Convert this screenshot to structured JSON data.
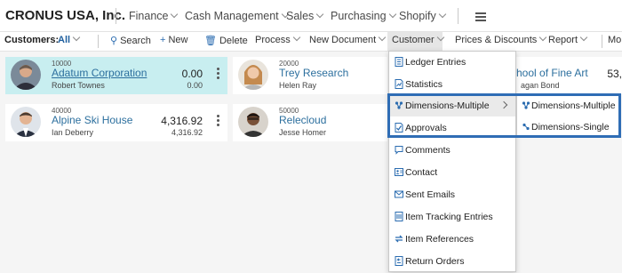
{
  "app": {
    "company": "CRONUS USA, Inc.",
    "nav": [
      {
        "label": "Finance"
      },
      {
        "label": "Cash Management"
      },
      {
        "label": "Sales"
      },
      {
        "label": "Purchasing"
      },
      {
        "label": "Shopify"
      }
    ]
  },
  "actions": {
    "customers_label": "Customers:",
    "filter_all": "All",
    "search": "Search",
    "new": "New",
    "delete": "Delete",
    "process": "Process",
    "new_document": "New Document",
    "customer": "Customer",
    "prices_discounts": "Prices & Discounts",
    "report": "Report",
    "more_clip": "Mo"
  },
  "customers": [
    {
      "number": "10000",
      "name": "Adatum Corporation",
      "contact": "Robert Townes",
      "balance": "0.00",
      "balance2": "0.00",
      "selected": true
    },
    {
      "number": "20000",
      "name": "Trey Research",
      "contact": "Helen Ray",
      "balance": "",
      "balance2": "",
      "selected": false
    },
    {
      "number": "",
      "name": "hool of Fine Art",
      "contact": "agan Bond",
      "balance": "53,",
      "balance2": "",
      "selected": false
    },
    {
      "number": "40000",
      "name": "Alpine Ski House",
      "contact": "Ian Deberry",
      "balance": "4,316.92",
      "balance2": "4,316.92",
      "selected": false
    },
    {
      "number": "50000",
      "name": "Relecloud",
      "contact": "Jesse Homer",
      "balance": "",
      "balance2": "",
      "selected": false
    }
  ],
  "menu": {
    "items": [
      {
        "label": "Ledger Entries",
        "icon": "ledger-icon"
      },
      {
        "label": "Statistics",
        "icon": "statistics-icon"
      },
      {
        "label": "Dimensions-Multiple",
        "icon": "dimensions-icon"
      },
      {
        "label": "Approvals",
        "icon": "approvals-icon"
      },
      {
        "label": "Comments",
        "icon": "comments-icon"
      },
      {
        "label": "Contact",
        "icon": "contact-icon"
      },
      {
        "label": "Sent Emails",
        "icon": "email-icon"
      },
      {
        "label": "Item Tracking Entries",
        "icon": "tracking-icon"
      },
      {
        "label": "Item References",
        "icon": "references-icon"
      },
      {
        "label": "Return Orders",
        "icon": "return-icon"
      }
    ],
    "submenu": [
      {
        "label": "Dimensions-Multiple",
        "icon": "dimensions-icon"
      },
      {
        "label": "Dimensions-Single",
        "icon": "dimensions-single-icon"
      }
    ]
  },
  "colors": {
    "accent": "#2c6f9e",
    "selected_card": "#c8eef0",
    "highlight_border": "#2f6db5"
  }
}
